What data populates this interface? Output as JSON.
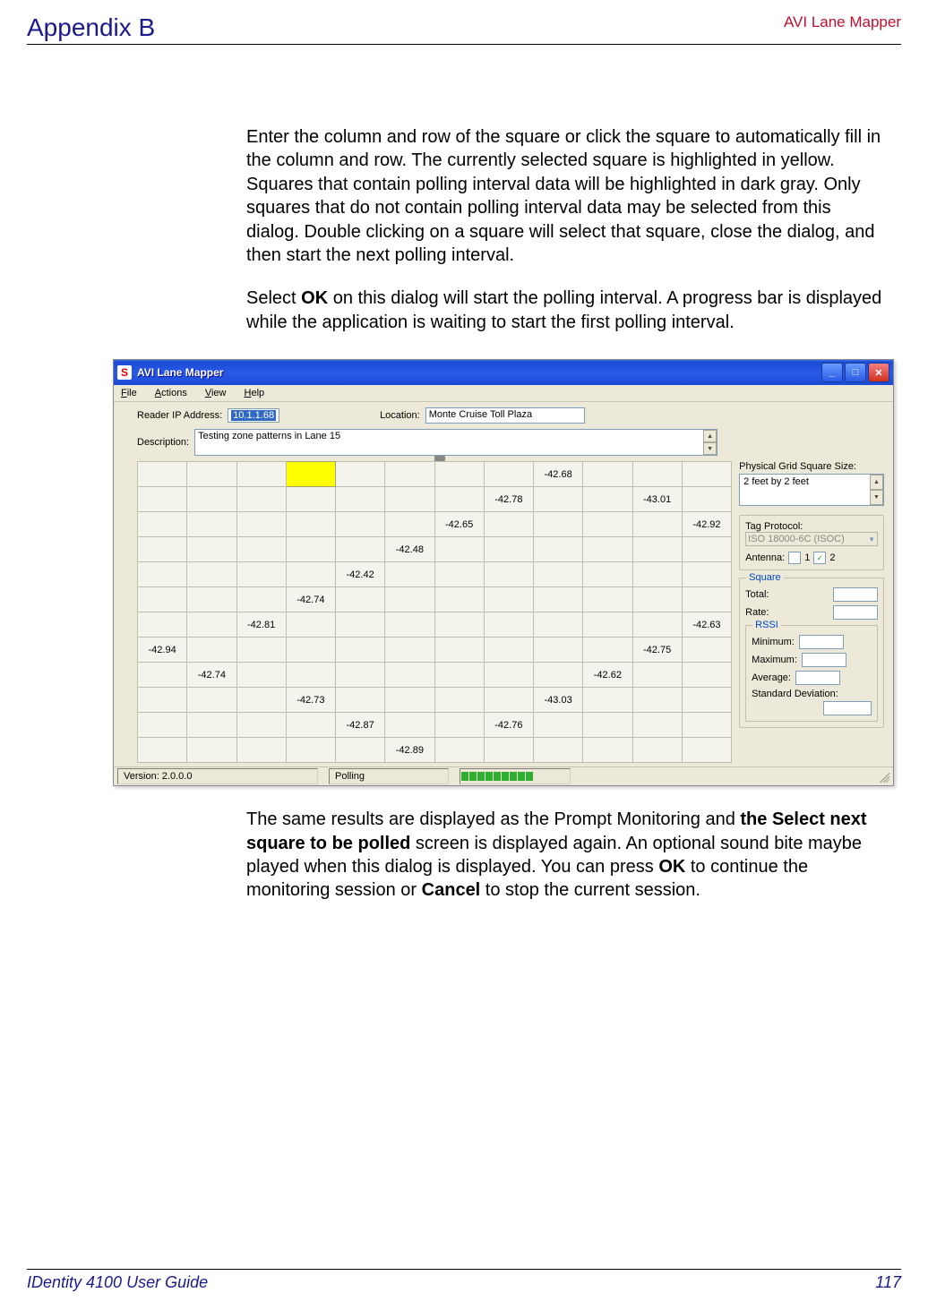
{
  "header": {
    "left": "Appendix B",
    "right": "AVI Lane Mapper"
  },
  "paragraph1": "Enter the column and row of the square or click the square to automatically fill in the column and row. The currently selected square is highlighted in yellow. Squares that contain polling interval data will be highlighted in dark gray. Only squares that do not contain polling interval data may be selected from this dialog. Double clicking on a square will select that square, close the dialog, and then start the next polling interval.",
  "para2_pre": "Select ",
  "para2_b1": "OK",
  "para2_post": " on this dialog will start the polling interval. A progress bar is displayed while the application is waiting to start the first polling interval.",
  "app": {
    "title": "AVI Lane Mapper",
    "menu_file": "File",
    "menu_actions": "Actions",
    "menu_view": "View",
    "menu_help": "Help",
    "reader_label": "Reader IP Address:",
    "reader_value": "10.1.1.68",
    "location_label": "Location:",
    "location_value": "Monte Cruise Toll Plaza",
    "description_label": "Description:",
    "description_value": "Testing zone patterns in Lane 15",
    "phys_label": "Physical Grid Square Size:",
    "phys_value": "2 feet by 2 feet",
    "tag_label": "Tag Protocol:",
    "tag_value": "ISO 18000-6C (ISOC)",
    "antenna_label": "Antenna:",
    "ant1": "1",
    "ant2": "2",
    "square_legend": "Square",
    "total_label": "Total:",
    "rate_label": "Rate:",
    "rssi_legend": "RSSI",
    "min_label": "Minimum:",
    "max_label": "Maximum:",
    "avg_label": "Average:",
    "std_label": "Standard Deviation:",
    "status_version": "Version: 2.0.0.0",
    "status_polling": "Polling"
  },
  "grid": [
    [
      "",
      "",
      "",
      "SEL",
      "",
      "",
      "",
      "",
      "-42.68",
      "",
      "",
      ""
    ],
    [
      "",
      "",
      "",
      "",
      "",
      "",
      "",
      "-42.78",
      "",
      "",
      "-43.01",
      ""
    ],
    [
      "",
      "",
      "",
      "",
      "",
      "",
      "-42.65",
      "",
      "",
      "",
      "",
      "-42.92"
    ],
    [
      "",
      "",
      "",
      "",
      "",
      "-42.48",
      "",
      "",
      "",
      "",
      "",
      ""
    ],
    [
      "",
      "",
      "",
      "",
      "-42.42",
      "",
      "",
      "",
      "",
      "",
      "",
      ""
    ],
    [
      "",
      "",
      "",
      "-42.74",
      "",
      "",
      "",
      "",
      "",
      "",
      "",
      ""
    ],
    [
      "",
      "",
      "-42.81",
      "",
      "",
      "",
      "",
      "",
      "",
      "",
      "",
      "-42.63"
    ],
    [
      "-42.94",
      "",
      "",
      "",
      "",
      "",
      "",
      "",
      "",
      "",
      "-42.75",
      ""
    ],
    [
      "",
      "-42.74",
      "",
      "",
      "",
      "",
      "",
      "",
      "",
      "-42.62",
      "",
      ""
    ],
    [
      "",
      "",
      "",
      "-42.73",
      "",
      "",
      "",
      "",
      "-43.03",
      "",
      "",
      ""
    ],
    [
      "",
      "",
      "",
      "",
      "-42.87",
      "",
      "",
      "-42.76",
      "",
      "",
      "",
      ""
    ],
    [
      "",
      "",
      "",
      "",
      "",
      "-42.89",
      "",
      "",
      "",
      "",
      "",
      ""
    ]
  ],
  "chart_data": {
    "type": "table",
    "title": "Polling grid RSSI values",
    "rows": 12,
    "cols": 12,
    "selected_cell": {
      "row": 0,
      "col": 3
    },
    "cells": [
      {
        "row": 0,
        "col": 8,
        "value": -42.68
      },
      {
        "row": 1,
        "col": 7,
        "value": -42.78
      },
      {
        "row": 1,
        "col": 10,
        "value": -43.01
      },
      {
        "row": 2,
        "col": 6,
        "value": -42.65
      },
      {
        "row": 2,
        "col": 11,
        "value": -42.92
      },
      {
        "row": 3,
        "col": 5,
        "value": -42.48
      },
      {
        "row": 4,
        "col": 4,
        "value": -42.42
      },
      {
        "row": 5,
        "col": 3,
        "value": -42.74
      },
      {
        "row": 6,
        "col": 2,
        "value": -42.81
      },
      {
        "row": 6,
        "col": 11,
        "value": -42.63
      },
      {
        "row": 7,
        "col": 0,
        "value": -42.94
      },
      {
        "row": 7,
        "col": 10,
        "value": -42.75
      },
      {
        "row": 8,
        "col": 1,
        "value": -42.74
      },
      {
        "row": 8,
        "col": 9,
        "value": -42.62
      },
      {
        "row": 9,
        "col": 3,
        "value": -42.73
      },
      {
        "row": 9,
        "col": 8,
        "value": -43.03
      },
      {
        "row": 10,
        "col": 4,
        "value": -42.87
      },
      {
        "row": 10,
        "col": 7,
        "value": -42.76
      },
      {
        "row": 11,
        "col": 5,
        "value": -42.89
      }
    ]
  },
  "para3_a": "The same results are displayed as the Prompt Monitoring and ",
  "para3_b1": "the Select next square to be polled",
  "para3_b": " screen is displayed again. An optional sound bite maybe played when this dialog is displayed. You can press ",
  "para3_b2": "OK",
  "para3_c": " to continue the monitoring session or ",
  "para3_b3": "Cancel",
  "para3_d": " to stop the current session.",
  "footer": {
    "left": "IDentity 4100 User Guide",
    "right": "117"
  }
}
